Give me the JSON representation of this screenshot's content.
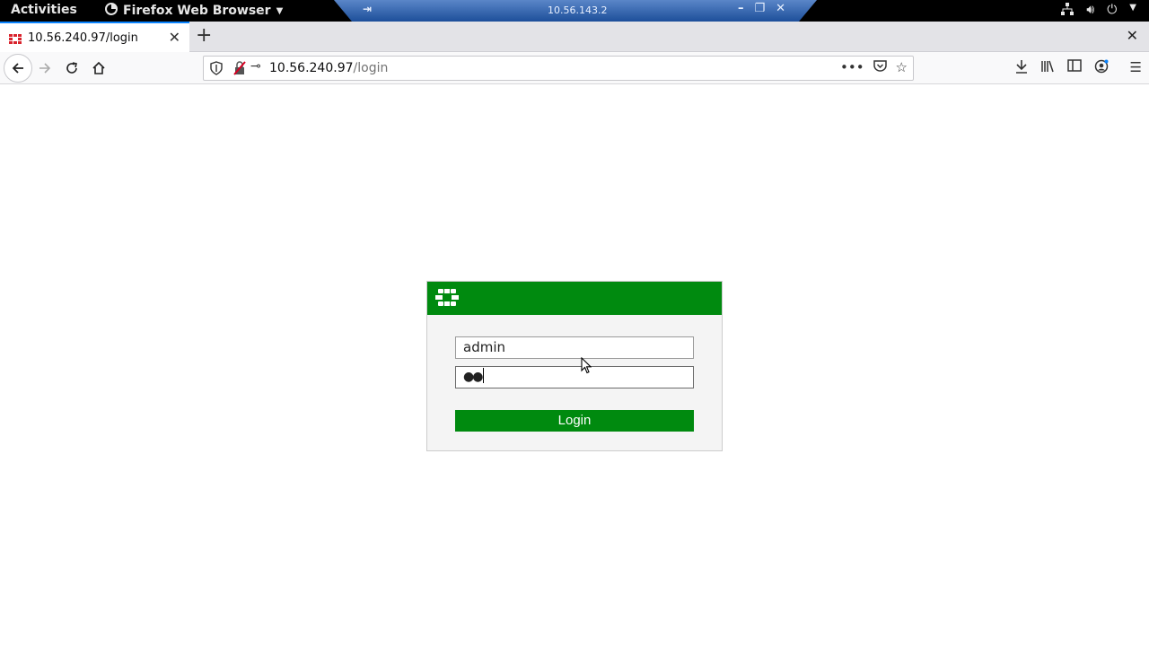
{
  "topbar": {
    "activities": "Activities",
    "app_name": "Firefox Web Browser",
    "remote_title": "10.56.143.2"
  },
  "browser": {
    "tab_title": "10.56.240.97/login",
    "url_host": "10.56.240.97",
    "url_path": "/login"
  },
  "login": {
    "username_value": "admin",
    "password_mask": "●●",
    "button_label": "Login"
  },
  "colors": {
    "brand_green": "#008a0f",
    "tab_accent": "#0a84ff"
  }
}
